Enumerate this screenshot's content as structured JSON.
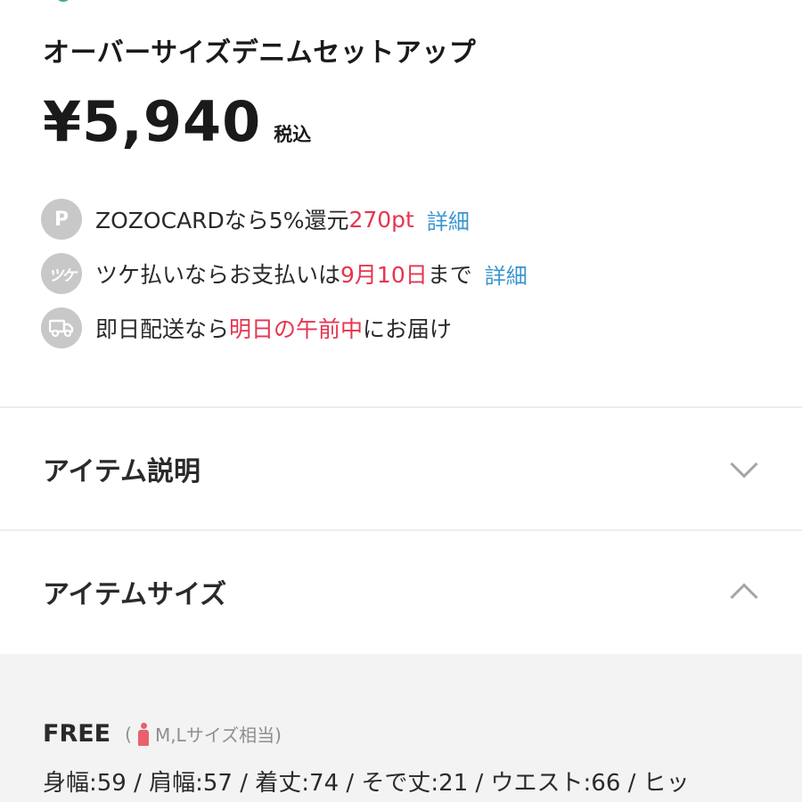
{
  "product": {
    "title": "オーバーサイズデニムセットアップ",
    "price": "¥5,940",
    "tax_label": "税込"
  },
  "benefits": [
    {
      "icon": "points-icon",
      "icon_text": "P",
      "text_before": "ZOZOCARDなら5%還元 ",
      "highlight": "270pt",
      "text_after": "",
      "link": "詳細"
    },
    {
      "icon": "tsuke-pay-icon",
      "icon_text": "ツケ",
      "text_before": "ツケ払いならお支払いは",
      "highlight": "9月10日",
      "text_after": "まで",
      "link": "詳細"
    },
    {
      "icon": "truck-icon",
      "icon_text": "",
      "text_before": "即日配送なら",
      "highlight": "明日の午前中",
      "text_after": "にお届け",
      "link": ""
    }
  ],
  "sections": {
    "description": {
      "label": "アイテム説明",
      "state": "collapsed"
    },
    "size": {
      "label": "アイテムサイズ",
      "state": "expanded"
    }
  },
  "size_info": {
    "name": "FREE",
    "note_open": "(",
    "note_text": "M,Lサイズ相当)",
    "measurements": "身幅:59 / 肩幅:57 / 着丈:74 / そで丈:21 / ウエスト:66 / ヒッ"
  },
  "colors": {
    "accent_red": "#e6354f",
    "link_blue": "#3a95d0",
    "icon_gray": "#c8c8c8",
    "panel_bg": "#f3f3f3"
  }
}
